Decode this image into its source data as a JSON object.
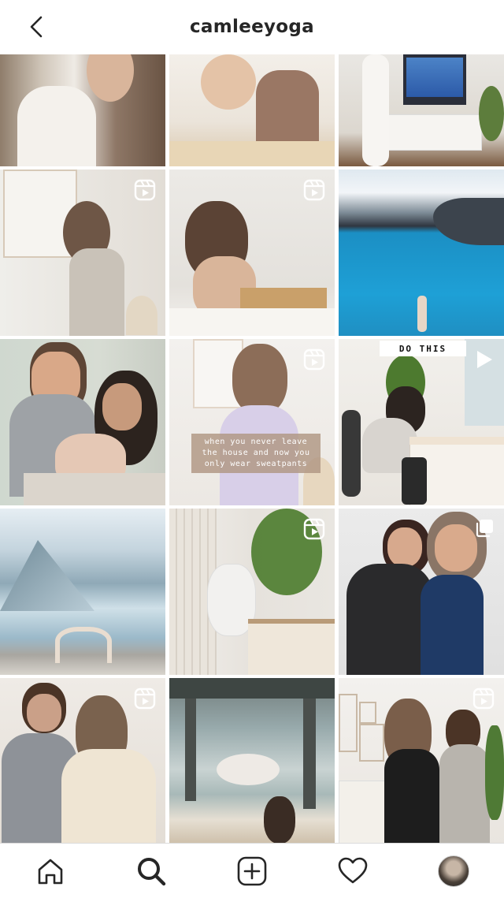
{
  "header": {
    "title": "camleeyoga",
    "back_icon": "chevron-left-icon"
  },
  "grid": {
    "tiles": [
      {
        "id": "post-1",
        "badge": "none",
        "colors": [
          "#9c8a76",
          "#e9e3dc",
          "#6b5645"
        ]
      },
      {
        "id": "post-2",
        "badge": "none",
        "colors": [
          "#efe8df",
          "#c9a98a",
          "#b28b6e"
        ]
      },
      {
        "id": "post-3",
        "badge": "none",
        "colors": [
          "#dcd7d0",
          "#f3f1ee",
          "#6b7c4a"
        ]
      },
      {
        "id": "post-4",
        "badge": "reel",
        "colors": [
          "#ecebe7",
          "#d8d2cb",
          "#6e5646"
        ]
      },
      {
        "id": "post-5",
        "badge": "reel",
        "colors": [
          "#e9e7e4",
          "#cbb09a",
          "#6d5443"
        ]
      },
      {
        "id": "post-6",
        "badge": "none",
        "colors": [
          "#e8eef3",
          "#1f8fc2",
          "#3a3f47"
        ]
      },
      {
        "id": "post-7",
        "badge": "none",
        "colors": [
          "#cfd7cf",
          "#7d6a5f",
          "#c9b1a0"
        ]
      },
      {
        "id": "post-8",
        "badge": "reel",
        "colors": [
          "#f2eee9",
          "#d9cde6",
          "#8d6e5b"
        ],
        "caption": "when you never leave the house and now you only wear sweatpants"
      },
      {
        "id": "post-9",
        "badge": "play",
        "colors": [
          "#f1efeb",
          "#d8d4cd",
          "#3b3b3b"
        ],
        "banner": "DO THIS"
      },
      {
        "id": "post-10",
        "badge": "none",
        "colors": [
          "#dce8ef",
          "#8fb4c8",
          "#6a8797"
        ]
      },
      {
        "id": "post-11",
        "badge": "reel",
        "colors": [
          "#efece7",
          "#cfcac2",
          "#5a7a3f"
        ]
      },
      {
        "id": "post-12",
        "badge": "multi",
        "colors": [
          "#e6e6e6",
          "#2f2f2f",
          "#1f3a66"
        ]
      },
      {
        "id": "post-13",
        "badge": "reel",
        "colors": [
          "#eae6e0",
          "#8a8e94",
          "#efe6d6"
        ]
      },
      {
        "id": "post-14",
        "badge": "none",
        "colors": [
          "#9fb1b3",
          "#5f6b6a",
          "#e9e4dc"
        ]
      },
      {
        "id": "post-15",
        "badge": "reel",
        "colors": [
          "#f1eeea",
          "#1e1e1e",
          "#b8b4ad"
        ]
      }
    ]
  },
  "tabbar": {
    "items": [
      {
        "name": "home",
        "icon": "home-icon"
      },
      {
        "name": "search",
        "icon": "search-icon",
        "active": true
      },
      {
        "name": "create",
        "icon": "plus-square-icon"
      },
      {
        "name": "activity",
        "icon": "heart-icon"
      },
      {
        "name": "profile",
        "icon": "avatar"
      }
    ]
  }
}
